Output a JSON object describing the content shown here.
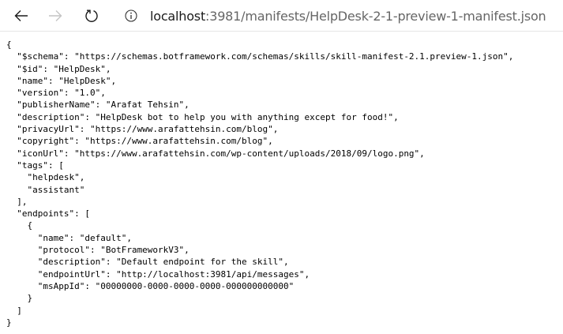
{
  "browser": {
    "url_host": "localhost",
    "url_rest": ":3981/manifests/HelpDesk-2-1-preview-1-manifest.json",
    "icons": [
      "back-arrow-icon",
      "forward-arrow-icon",
      "refresh-icon",
      "info-icon"
    ]
  },
  "json_lines": [
    "{",
    "  \"$schema\": \"https://schemas.botframework.com/schemas/skills/skill-manifest-2.1.preview-1.json\",",
    "  \"$id\": \"HelpDesk\",",
    "  \"name\": \"HelpDesk\",",
    "  \"version\": \"1.0\",",
    "  \"publisherName\": \"Arafat Tehsin\",",
    "  \"description\": \"HelpDesk bot to help you with anything except for food!\",",
    "  \"privacyUrl\": \"https://www.arafattehsin.com/blog\",",
    "  \"copyright\": \"https://www.arafattehsin.com/blog\",",
    "  \"iconUrl\": \"https://www.arafattehsin.com/wp-content/uploads/2018/09/logo.png\",",
    "  \"tags\": [",
    "    \"helpdesk\",",
    "    \"assistant\"",
    "  ],",
    "  \"endpoints\": [",
    "    {",
    "      \"name\": \"default\",",
    "      \"protocol\": \"BotFrameworkV3\",",
    "      \"description\": \"Default endpoint for the skill\",",
    "      \"endpointUrl\": \"http://localhost:3981/api/messages\",",
    "      \"msAppId\": \"00000000-0000-0000-0000-000000000000\"",
    "    }",
    "  ]",
    "}"
  ]
}
